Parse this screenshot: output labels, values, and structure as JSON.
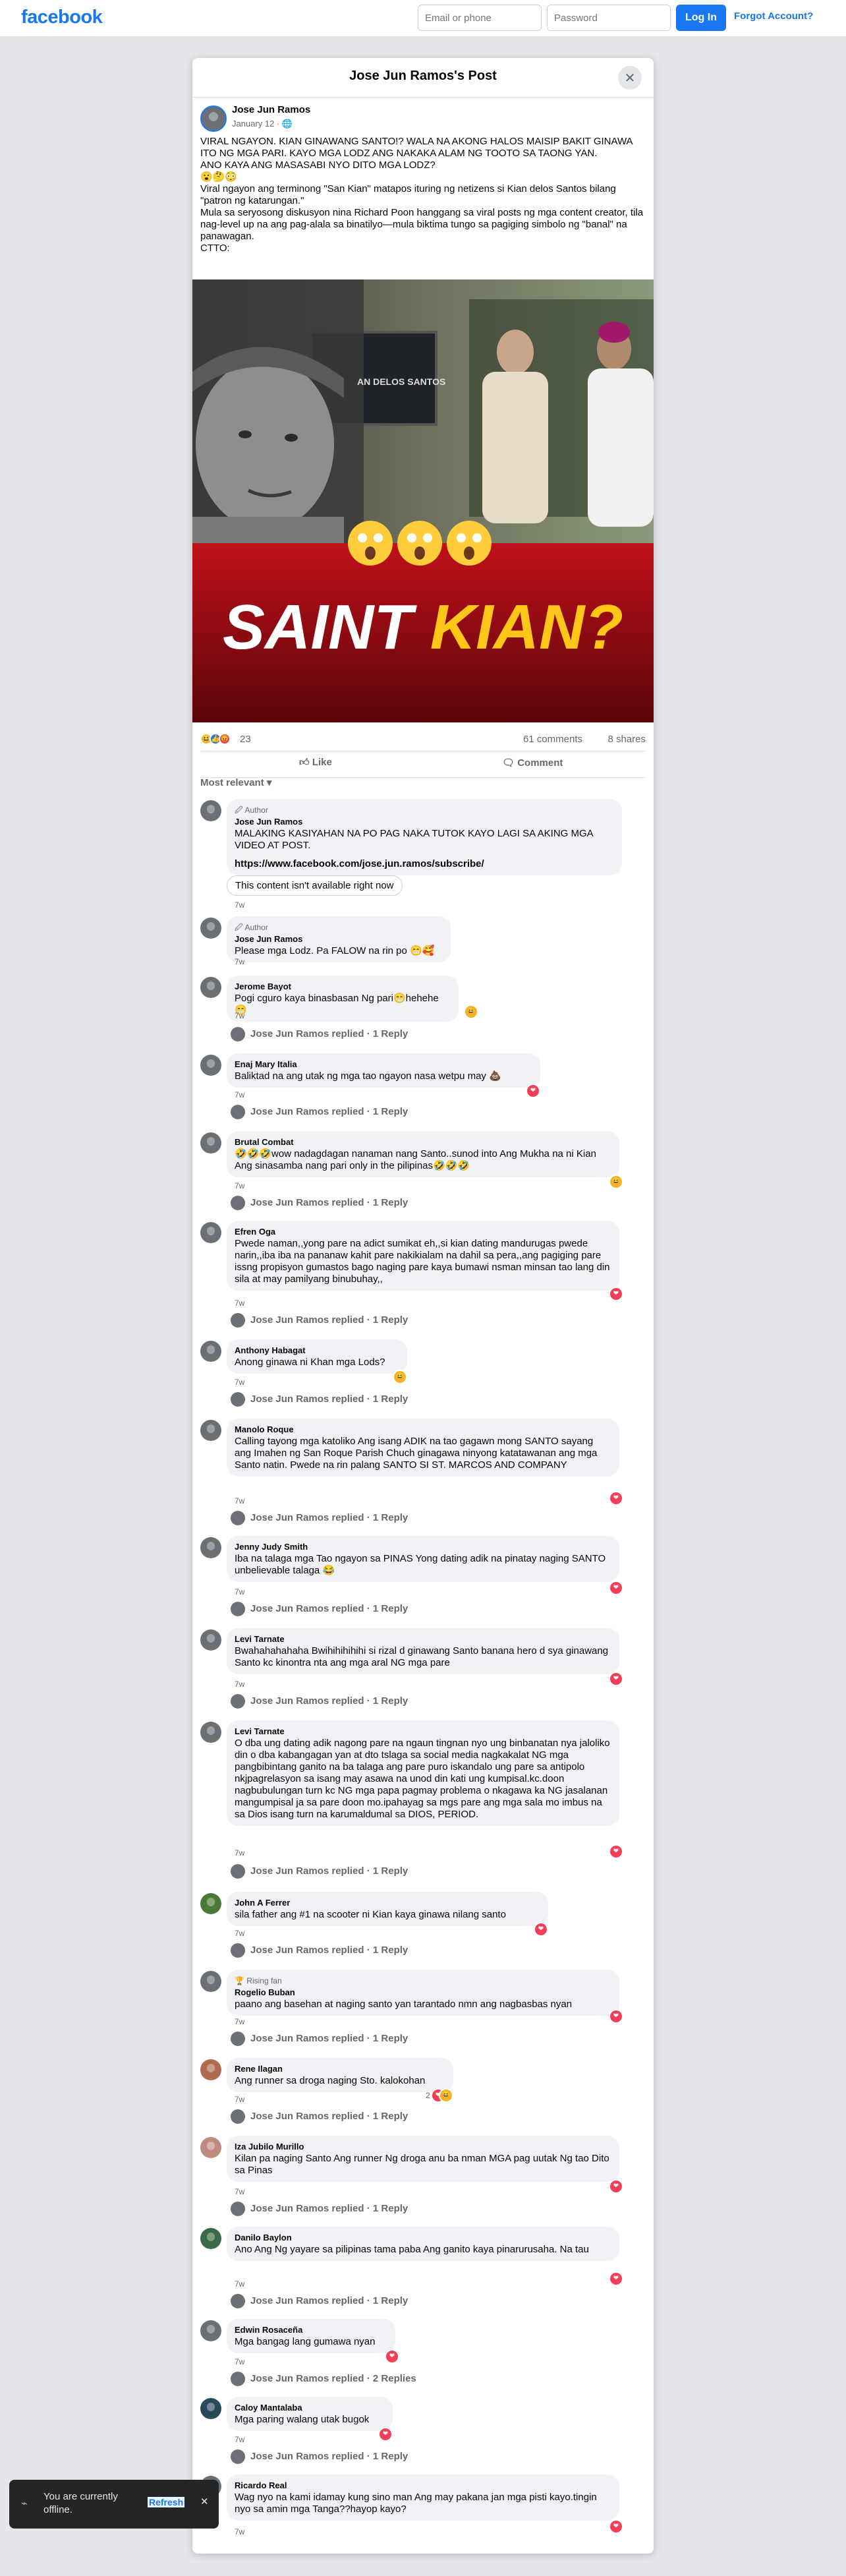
{
  "header": {
    "logo": "facebook",
    "email_placeholder": "Email or phone",
    "password_placeholder": "Password",
    "login_label": "Log In",
    "forgot_label": "Forgot Account?"
  },
  "modal": {
    "title": "Jose Jun Ramos's Post",
    "close_icon": "close-icon"
  },
  "post": {
    "author": "Jose Jun Ramos",
    "date": "January 12 · ",
    "text": "VIRAL NGAYON. KIAN GINAWANG SANTO!? WALA NA AKONG HALOS MAISIP BAKIT GINAWA ITO NG MGA PARI. KAYO MGA LODZ ANG NAKAKA ALAM NG TOOTO SA TAONG YAN.\nANO KAYA ANG MASASABI NYO DITO MGA LODZ?\n😮🤔😳\nViral ngayon ang terminong \"San Kian\" matapos ituring ng netizens si Kian delos Santos bilang \"patron ng katarungan.\"\nMula sa seryosong diskusyon nina Richard Poon hanggang sa viral posts ng mga content creator, tila nag-level up na ang pag-alala sa binatilyo—mula biktima tungo sa pagiging simbolo ng \"banal\" na panawagan.\nCTTO:",
    "image_text": {
      "plaque": "AN DELOS SANTOS",
      "headline_white": "SAINT ",
      "headline_yellow": "KIAN?"
    },
    "reaction_count": "23",
    "comments_count": "61 comments",
    "shares_count": "8 shares",
    "like_label": "Like",
    "comment_label": "Comment",
    "sort_label": "Most relevant"
  },
  "comments": [
    {
      "badge": "🖉 Author",
      "name": "Jose Jun Ramos",
      "text": "MALAKING KASIYAHAN NA PO PAG NAKA TUTOK KAYO LAGI SA AKING MGA VIDEO AT POST.",
      "link": "https://www.facebook.com/jose.jun.ramos/subscribe/",
      "unavailable": "This content isn't available right now",
      "time": "7w"
    },
    {
      "badge": "🖉 Author",
      "name": "Jose Jun Ramos",
      "text": "Please mga Lodz. Pa FALOW na rin po 😁🥰",
      "time": "7w"
    },
    {
      "name": "Jerome Bayot",
      "text": "Pogi cguro kaya binasbasan Ng pari😁hehehe😁",
      "time": "7w",
      "reply": "Jose Jun Ramos replied · 1 Reply"
    },
    {
      "name": "Enaj Mary Italia",
      "text": "Baliktad na ang utak ng mga tao ngayon nasa wetpu may 💩",
      "time": "7w",
      "reply": "Jose Jun Ramos replied · 1 Reply"
    },
    {
      "name": "Brutal Combat",
      "text": "🤣🤣🤣wow nadagdagan nanaman nang Santo..sunod into Ang Mukha na ni Kian Ang sinasamba nang pari only in the pilipinas🤣🤣🤣",
      "time": "7w",
      "reply": "Jose Jun Ramos replied · 1 Reply"
    },
    {
      "name": "Efren Oga",
      "text": "Pwede naman,,yong pare na adict sumikat eh,,si kian dating mandurugas pwede narin,,iba iba na pananaw kahit pare nakikialam na dahil sa pera,,ang pagiging pare issng propisyon gumastos bago naging pare kaya bumawi nsman minsan tao lang din sila at may pamilyang binubuhay,,",
      "time": "7w",
      "reply": "Jose Jun Ramos replied · 1 Reply"
    },
    {
      "name": "Anthony Habagat",
      "text": "Anong ginawa ni Khan mga Lods?",
      "time": "7w",
      "reply": "Jose Jun Ramos replied · 1 Reply"
    },
    {
      "name": "Manolo Roque",
      "text": "Calling tayong mga katoliko Ang isang ADIK na tao gagawn mong SANTO sayang ang Imahen ng San Roque Parish Chuch ginagawa ninyong katatawanan ang mga Santo natin. Pwede na rin palang SANTO SI ST. MARCOS AND COMPANY",
      "time": "7w",
      "reply": "Jose Jun Ramos replied · 1 Reply"
    },
    {
      "name": "Jenny Judy Smith",
      "text": "Iba na talaga mga Tao ngayon sa PINAS Yong dating adik na pinatay naging SANTO unbelievable talaga 😂",
      "time": "7w",
      "reply": "Jose Jun Ramos replied · 1 Reply"
    },
    {
      "name": "Levi Tarnate",
      "text": "Bwahahahahaha Bwihihihihihi si rizal d ginawang Santo banana hero d sya ginawang Santo kc kinontra nta ang mga aral NG mga pare",
      "time": "7w",
      "reply": "Jose Jun Ramos replied · 1 Reply"
    },
    {
      "name": "Levi Tarnate",
      "text": "O dba ung dating adik nagong pare na ngaun tingnan nyo ung binbanatan nya jaloliko din o dba kabangagan yan at dto tslaga sa social media nagkakalat NG mga pangbibintang ganito na ba talaga ang pare puro iskandalo ung pare sa antipolo nkjpagrelasyon sa isang may asawa na unod din kati ung kumpisal.kc.doon nagbubulungan turn kc NG mga papa pagmay problema o nkagawa ka NG jasalanan mangumpisal ja sa pare doon mo.ipahayag sa mgs pare ang mga sala mo imbus na sa Dios isang turn na karumaldumal sa DIOS, PERIOD.",
      "time": "7w",
      "reply": "Jose Jun Ramos replied · 1 Reply"
    },
    {
      "name": "John A Ferrer",
      "text": "sila father ang #1 na scooter ni Kian kaya ginawa nilang santo",
      "time": "7w",
      "reply": "Jose Jun Ramos replied · 1 Reply"
    },
    {
      "badge": "🏆 Rising fan",
      "name": "Rogelio Buban",
      "text": "paano ang basehan at naging santo yan tarantado nmn ang nagbasbas nyan",
      "time": "7w",
      "reply": "Jose Jun Ramos replied · 1 Reply"
    },
    {
      "name": "Rene Ilagan",
      "text": "Ang runner sa droga naging Sto. kalokohan",
      "time": "7w",
      "count": "2",
      "reply": "Jose Jun Ramos replied · 1 Reply"
    },
    {
      "name": "Iza Jubilo Murillo",
      "text": "Kilan pa naging Santo Ang runner Ng droga anu ba nman MGA pag uutak Ng tao Dito sa Pinas",
      "time": "7w",
      "reply": "Jose Jun Ramos replied · 1 Reply"
    },
    {
      "name": "Danilo Baylon",
      "text": "Ano Ang Ng yayare sa pilipinas tama paba Ang ganito kaya pinarurusaha. Na tau",
      "time": "7w",
      "reply": "Jose Jun Ramos replied · 1 Reply"
    },
    {
      "name": "Edwin Rosaceña",
      "text": "Mga bangag lang gumawa nyan",
      "time": "7w",
      "reply": "Jose Jun Ramos replied · 2 Replies"
    },
    {
      "name": "Caloy Mantalaba",
      "text": "Mga paring walang utak bugok",
      "time": "7w",
      "reply": "Jose Jun Ramos replied · 1 Reply"
    },
    {
      "name": "Ricardo Real",
      "text": "Wag nyo na kami idamay kung sino man Ang may pakana jan mga pisti kayo.tingin nyo sa amin mga Tanga??hayop kayo?",
      "time": "7w"
    }
  ],
  "toast": {
    "message": "You are currently offline.",
    "action": "Refresh"
  }
}
